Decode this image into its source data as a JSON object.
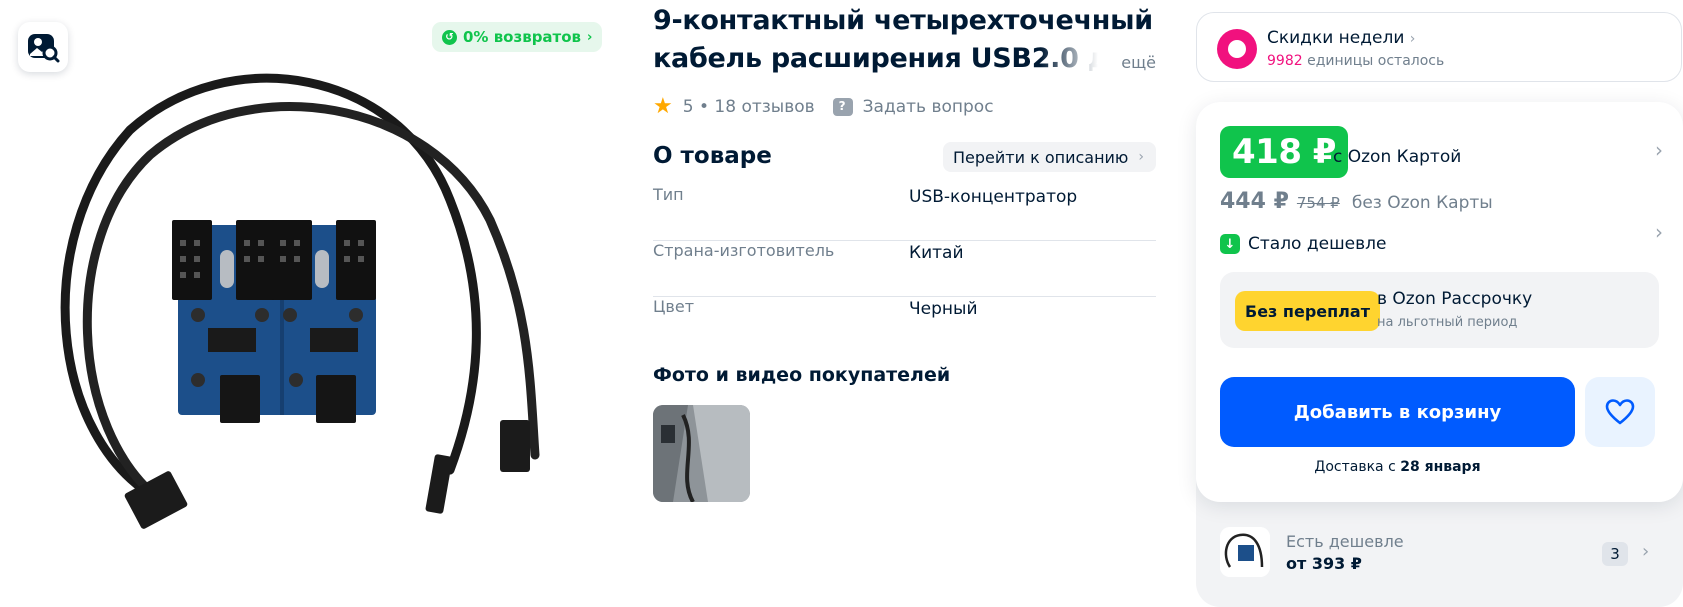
{
  "gallery": {
    "returns_badge": "0% возвратов"
  },
  "product": {
    "title_line1": "9-контактный четырехточечный",
    "title_line2": "кабель расширения USB2.0 для",
    "more_link": "ещё",
    "rating": "5",
    "separator": "•",
    "reviews": "18 отзывов",
    "ask_question": "Задать вопрос"
  },
  "about": {
    "title": "О товаре",
    "to_description": "Перейти к описанию",
    "specs": [
      {
        "key": "Тип",
        "value": "USB-концентратор"
      },
      {
        "key": "Страна-изготовитель",
        "value": "Китай"
      },
      {
        "key": "Цвет",
        "value": "Черный"
      }
    ]
  },
  "ugc": {
    "title": "Фото и видео покупателей"
  },
  "weekly_discount": {
    "title": "Скидки недели",
    "count": "9982",
    "remaining": "единицы осталось"
  },
  "price": {
    "ozon_card_price": "418 ₽",
    "ozon_card_label": "с Ozon Картой",
    "regular_price": "444 ₽",
    "old_price": "754 ₽",
    "no_card_label": "без Ozon Карты",
    "price_drop": "Стало дешевле",
    "installment_pill": "Без переплат",
    "installment_title": "в Ozon Рассрочку",
    "installment_sub": "на льготный период",
    "add_to_cart": "Добавить в корзину",
    "delivery_prefix": "Доставка с",
    "delivery_date": "28 января"
  },
  "cheaper_offer": {
    "label": "Есть дешевле",
    "price": "от 393 ₽",
    "count": "3"
  },
  "colors": {
    "ozon_green": "#10c44c",
    "ozon_blue": "#005bff",
    "ozon_pink": "#f1117e",
    "installment_yellow": "#ffd42f",
    "star": "#ffa800"
  }
}
